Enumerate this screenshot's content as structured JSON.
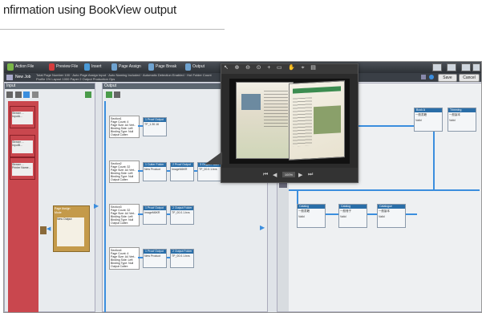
{
  "heading": "nfirmation using BookView output",
  "toolbar": {
    "items": [
      "Action File",
      "Preview File",
      "Insert",
      "Page Assign",
      "Page Break",
      "Output"
    ],
    "new_job": "New Job",
    "job_info": "Total Page Number 100 · Auto Page Assign Input · Auto Naming Included · Automatic Detection Enabled · Hot Folder Count Profile 1% Layout 1000 Paper 2 Output Production Ops",
    "save": "Save",
    "cancel": "Cancel"
  },
  "panels": {
    "input_label": "Input",
    "output_label": "Output"
  },
  "input_items": [
    {
      "label": "Stream ... InputA..."
    },
    {
      "label": "Stream ... InputB..."
    },
    {
      "label": "Stream ... Printer Name..."
    }
  ],
  "page_assign": {
    "title": "Page Assign",
    "subtitle": "Mode",
    "node": "New Output"
  },
  "rows": [
    {
      "card": [
        "Section1",
        "Page Count: 4",
        "Page Size: A4 Vert..",
        "Binding Side: Left",
        "Binding Type: Null",
        "Output Cutter:"
      ],
      "nodes": [
        {
          "num": "1",
          "title": "Proof Output",
          "body": "TP_1.30.16"
        }
      ]
    },
    {
      "card": [
        "Section2",
        "Page Count: 32",
        "Page Size: A4 Vert..",
        "Binding Side: Left",
        "Binding Type: Null",
        "Output Cutter:"
      ],
      "nodes": [
        {
          "num": "1",
          "title": "Cutter Folder",
          "body": "New Product"
        },
        {
          "num": "2",
          "title": "Proof Output",
          "body": "ImageM6KR"
        },
        {
          "num": "3",
          "title": "Output Folder",
          "body": "TP_00.0.1.bvs"
        }
      ]
    },
    {
      "card": [
        "Section3",
        "Page Count: 32",
        "Page Size: A4 Vert..",
        "Binding Side: Left",
        "Binding Type: Null",
        "Output Cutter:"
      ],
      "nodes": [
        {
          "num": "1",
          "title": "Proof Output",
          "body": "ImageM6KR"
        },
        {
          "num": "2",
          "title": "Output Folder",
          "body": "TP_00.0.1.bvs"
        }
      ]
    },
    {
      "card": [
        "Section4",
        "Page Count: 4",
        "Page Size: A4 Vert..",
        "Binding Side: Left",
        "Binding Type: Null",
        "Output Cutter:"
      ],
      "nodes": [
        {
          "num": "1",
          "title": "Proof Output",
          "body": "New Product"
        },
        {
          "num": "2",
          "title": "Output Folder",
          "body": "TP_00.0.1.bvs"
        }
      ]
    }
  ],
  "right_nodes_top": [
    {
      "title": "Book A",
      "body": "一般書籍",
      "sub": "Valid"
    },
    {
      "title": "Trimming",
      "body": "一般製本",
      "sub": "Valid"
    }
  ],
  "right_nodes_bottom": [
    {
      "title": "Catalog",
      "body": "一般書籍",
      "sub": "Valid"
    },
    {
      "title": "Catalog",
      "body": "一般冊子",
      "sub": "Valid"
    },
    {
      "title": "Catalogue",
      "body": "一般製本",
      "sub": "Valid"
    }
  ],
  "popup": {
    "status_zoom": "100%"
  },
  "colors": {
    "flow_blue": "#3b8ede",
    "node_header": "#2a6ea8",
    "red_tab": "#c9474e"
  }
}
